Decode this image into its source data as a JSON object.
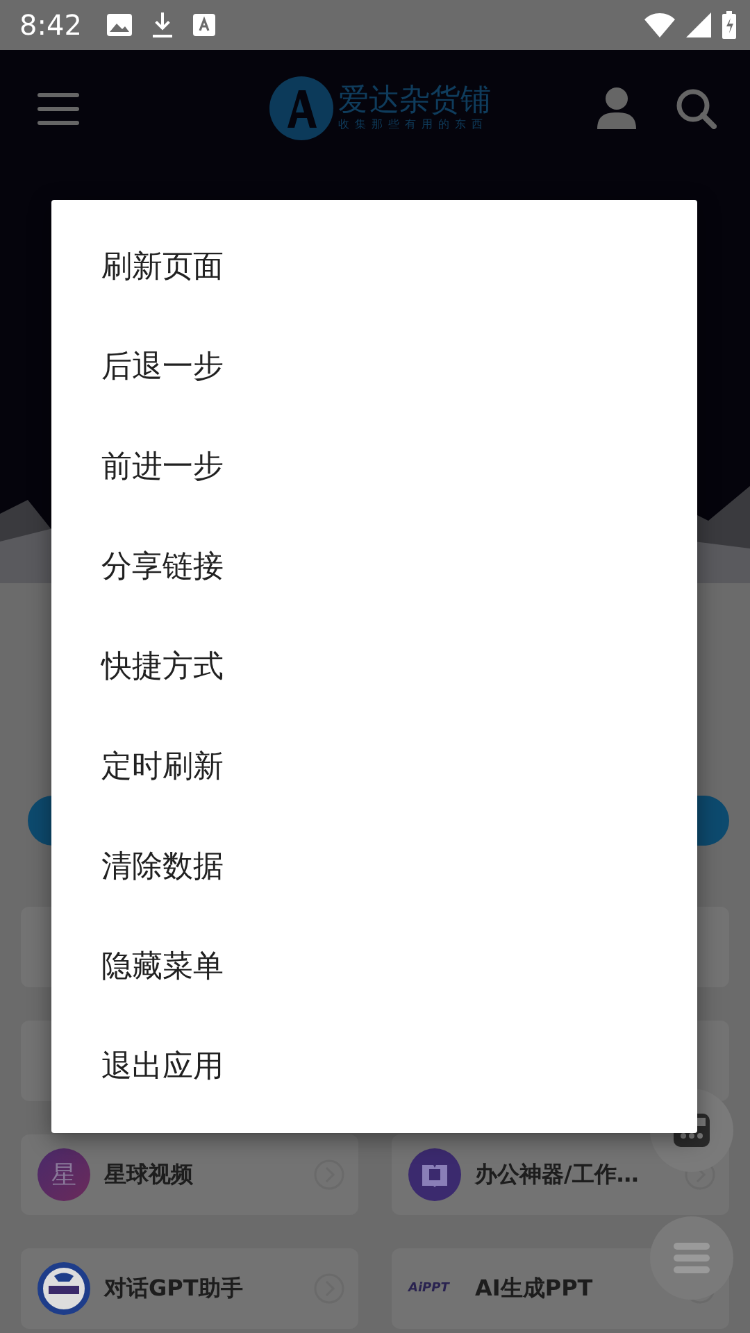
{
  "status_bar": {
    "time": "8:42"
  },
  "header": {
    "logo_title": "爱达杂货铺",
    "logo_subtitle": "收集那些有用的东西"
  },
  "cards": [
    {
      "kind": "letter",
      "title": "星球视频",
      "icon_text": "星"
    },
    {
      "kind": "book",
      "title": "办公神器/工作…"
    },
    {
      "kind": "mask",
      "title": "对话GPT助手"
    },
    {
      "kind": "logo",
      "title": "AI生成PPT",
      "icon_text": "AiPPT"
    }
  ],
  "menu": {
    "items": [
      {
        "label": "刷新页面"
      },
      {
        "label": "后退一步"
      },
      {
        "label": "前进一步"
      },
      {
        "label": "分享链接"
      },
      {
        "label": "快捷方式"
      },
      {
        "label": "定时刷新"
      },
      {
        "label": "清除数据"
      },
      {
        "label": "隐藏菜单"
      },
      {
        "label": "退出应用"
      }
    ]
  }
}
